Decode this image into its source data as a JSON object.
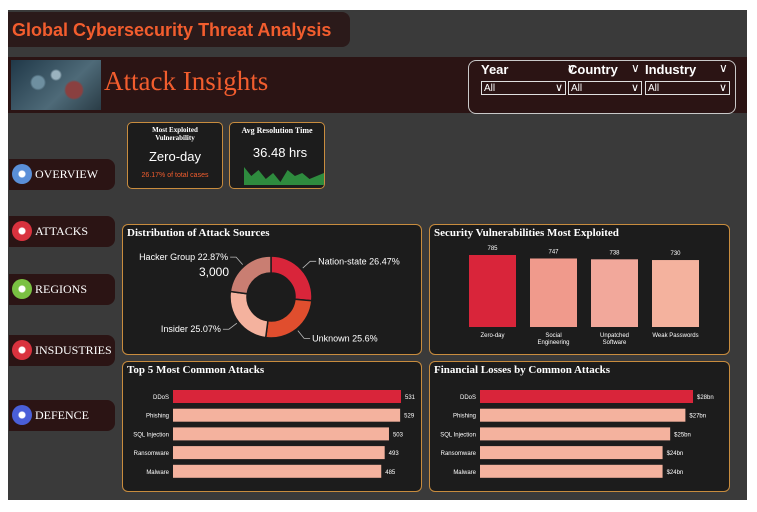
{
  "header": {
    "dashboard_title": "Global Cybersecurity Threat Analysis",
    "page_title": "Attack Insights"
  },
  "filters": [
    {
      "label": "Year",
      "value": "All"
    },
    {
      "label": "Country",
      "value": "All"
    },
    {
      "label": "Industry",
      "value": "All"
    }
  ],
  "nav": [
    {
      "label": "OVERVIEW",
      "icon": "computer-shield-icon",
      "color": "#5a8fd8"
    },
    {
      "label": "ATTACKS",
      "icon": "monitor-alert-icon",
      "color": "#d9323e"
    },
    {
      "label": "REGIONS",
      "icon": "globe-icon",
      "color": "#7ac142"
    },
    {
      "label": "INSDUSTRIES",
      "icon": "factory-icon",
      "color": "#d9323e"
    },
    {
      "label": "DEFENCE",
      "icon": "shield-sword-icon",
      "color": "#4a5fd8"
    }
  ],
  "kpis": {
    "exploited": {
      "title": "Most Exploited Vulnerability",
      "value": "Zero-day",
      "sub": "26.17% of total cases"
    },
    "resolution": {
      "title": "Avg Resolution Time",
      "value": "36.48 hrs",
      "sparkline": [
        6,
        3,
        5,
        2,
        4,
        1,
        5,
        3,
        4,
        2,
        3,
        4
      ]
    }
  },
  "colors": {
    "accent": "#f25d2e",
    "bar_highlight": "#d9253a",
    "bar_light": "#f4b29e",
    "card_border": "#c88c3e"
  },
  "chart_data": [
    {
      "type": "pie",
      "title": "Distribution of Attack Sources",
      "center_label": "3,000",
      "categories": [
        "Nation-state",
        "Unknown",
        "Insider",
        "Hacker Group"
      ],
      "values": [
        26.47,
        25.6,
        25.07,
        22.87
      ],
      "labels": [
        "Nation-state 26.47%",
        "Unknown 25.6%",
        "Insider 25.07%",
        "Hacker Group 22.87%"
      ],
      "colors": [
        "#d9253a",
        "#e04e2e",
        "#f4b29e",
        "#c97e72"
      ]
    },
    {
      "type": "bar",
      "title": "Security Vulnerabilities Most Exploited",
      "categories": [
        "Zero-day",
        "Social Engineering",
        "Unpatched Software",
        "Weak Passwords"
      ],
      "category_lines": [
        [
          "Zero-day"
        ],
        [
          "Social",
          "Engineering"
        ],
        [
          "Unpatched",
          "Software"
        ],
        [
          "Weak Passwords"
        ]
      ],
      "values": [
        785,
        747,
        738,
        730
      ],
      "colors": [
        "#d9253a",
        "#f09a8c",
        "#f2a89b",
        "#f4b29e"
      ]
    },
    {
      "type": "bar",
      "orientation": "horizontal",
      "title": "Top 5 Most Common Attacks",
      "categories": [
        "DDoS",
        "Phishing",
        "SQL Injection",
        "Ransomware",
        "Malware"
      ],
      "values": [
        531,
        529,
        503,
        493,
        485
      ],
      "value_labels": [
        "531",
        "529",
        "503",
        "493",
        "485"
      ]
    },
    {
      "type": "bar",
      "orientation": "horizontal",
      "title": "Financial Losses by Common Attacks",
      "categories": [
        "DDoS",
        "Phishing",
        "SQL Injection",
        "Ransomware",
        "Malware"
      ],
      "values": [
        28,
        27,
        25,
        24,
        24
      ],
      "value_labels": [
        "$28bn",
        "$27bn",
        "$25bn",
        "$24bn",
        "$24bn"
      ]
    }
  ]
}
